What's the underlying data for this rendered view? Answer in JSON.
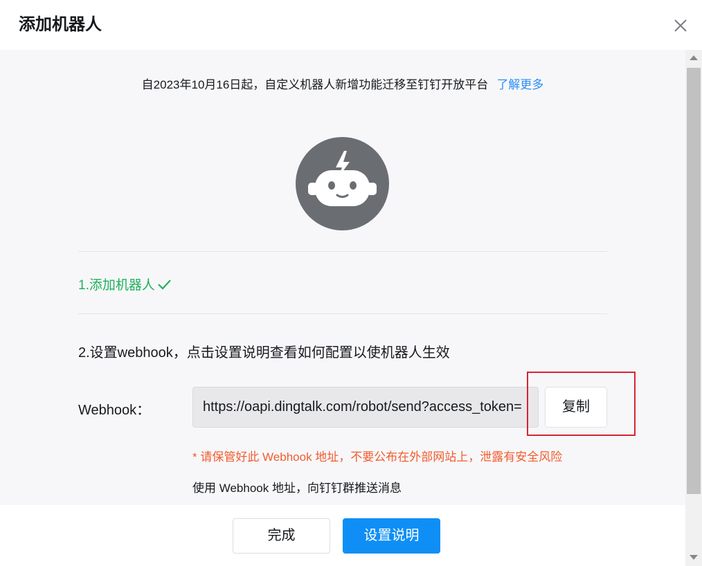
{
  "dialog": {
    "title": "添加机器人"
  },
  "notice": {
    "text": "自2023年10月16日起，自定义机器人新增功能迁移至钉钉开放平台",
    "link": "了解更多"
  },
  "steps": {
    "step1": "1.添加机器人",
    "step2": "2.设置webhook，点击设置说明查看如何配置以使机器人生效"
  },
  "webhook": {
    "label": "Webhook：",
    "value": "https://oapi.dingtalk.com/robot/send?access_token=",
    "copy_label": "复制",
    "warning": "* 请保管好此 Webhook 地址，不要公布在外部网站上，泄露有安全风险",
    "usage": "使用 Webhook 地址，向钉钉群推送消息"
  },
  "footer": {
    "done_label": "完成",
    "docs_label": "设置说明"
  },
  "icons": {
    "close": "close-icon",
    "robot": "robot-icon",
    "check": "check-icon"
  },
  "colors": {
    "accent": "#0f8ff5",
    "link": "#2a8ff7",
    "success": "#20b05c",
    "warning": "#f25c2f",
    "highlight": "#d9232f"
  }
}
